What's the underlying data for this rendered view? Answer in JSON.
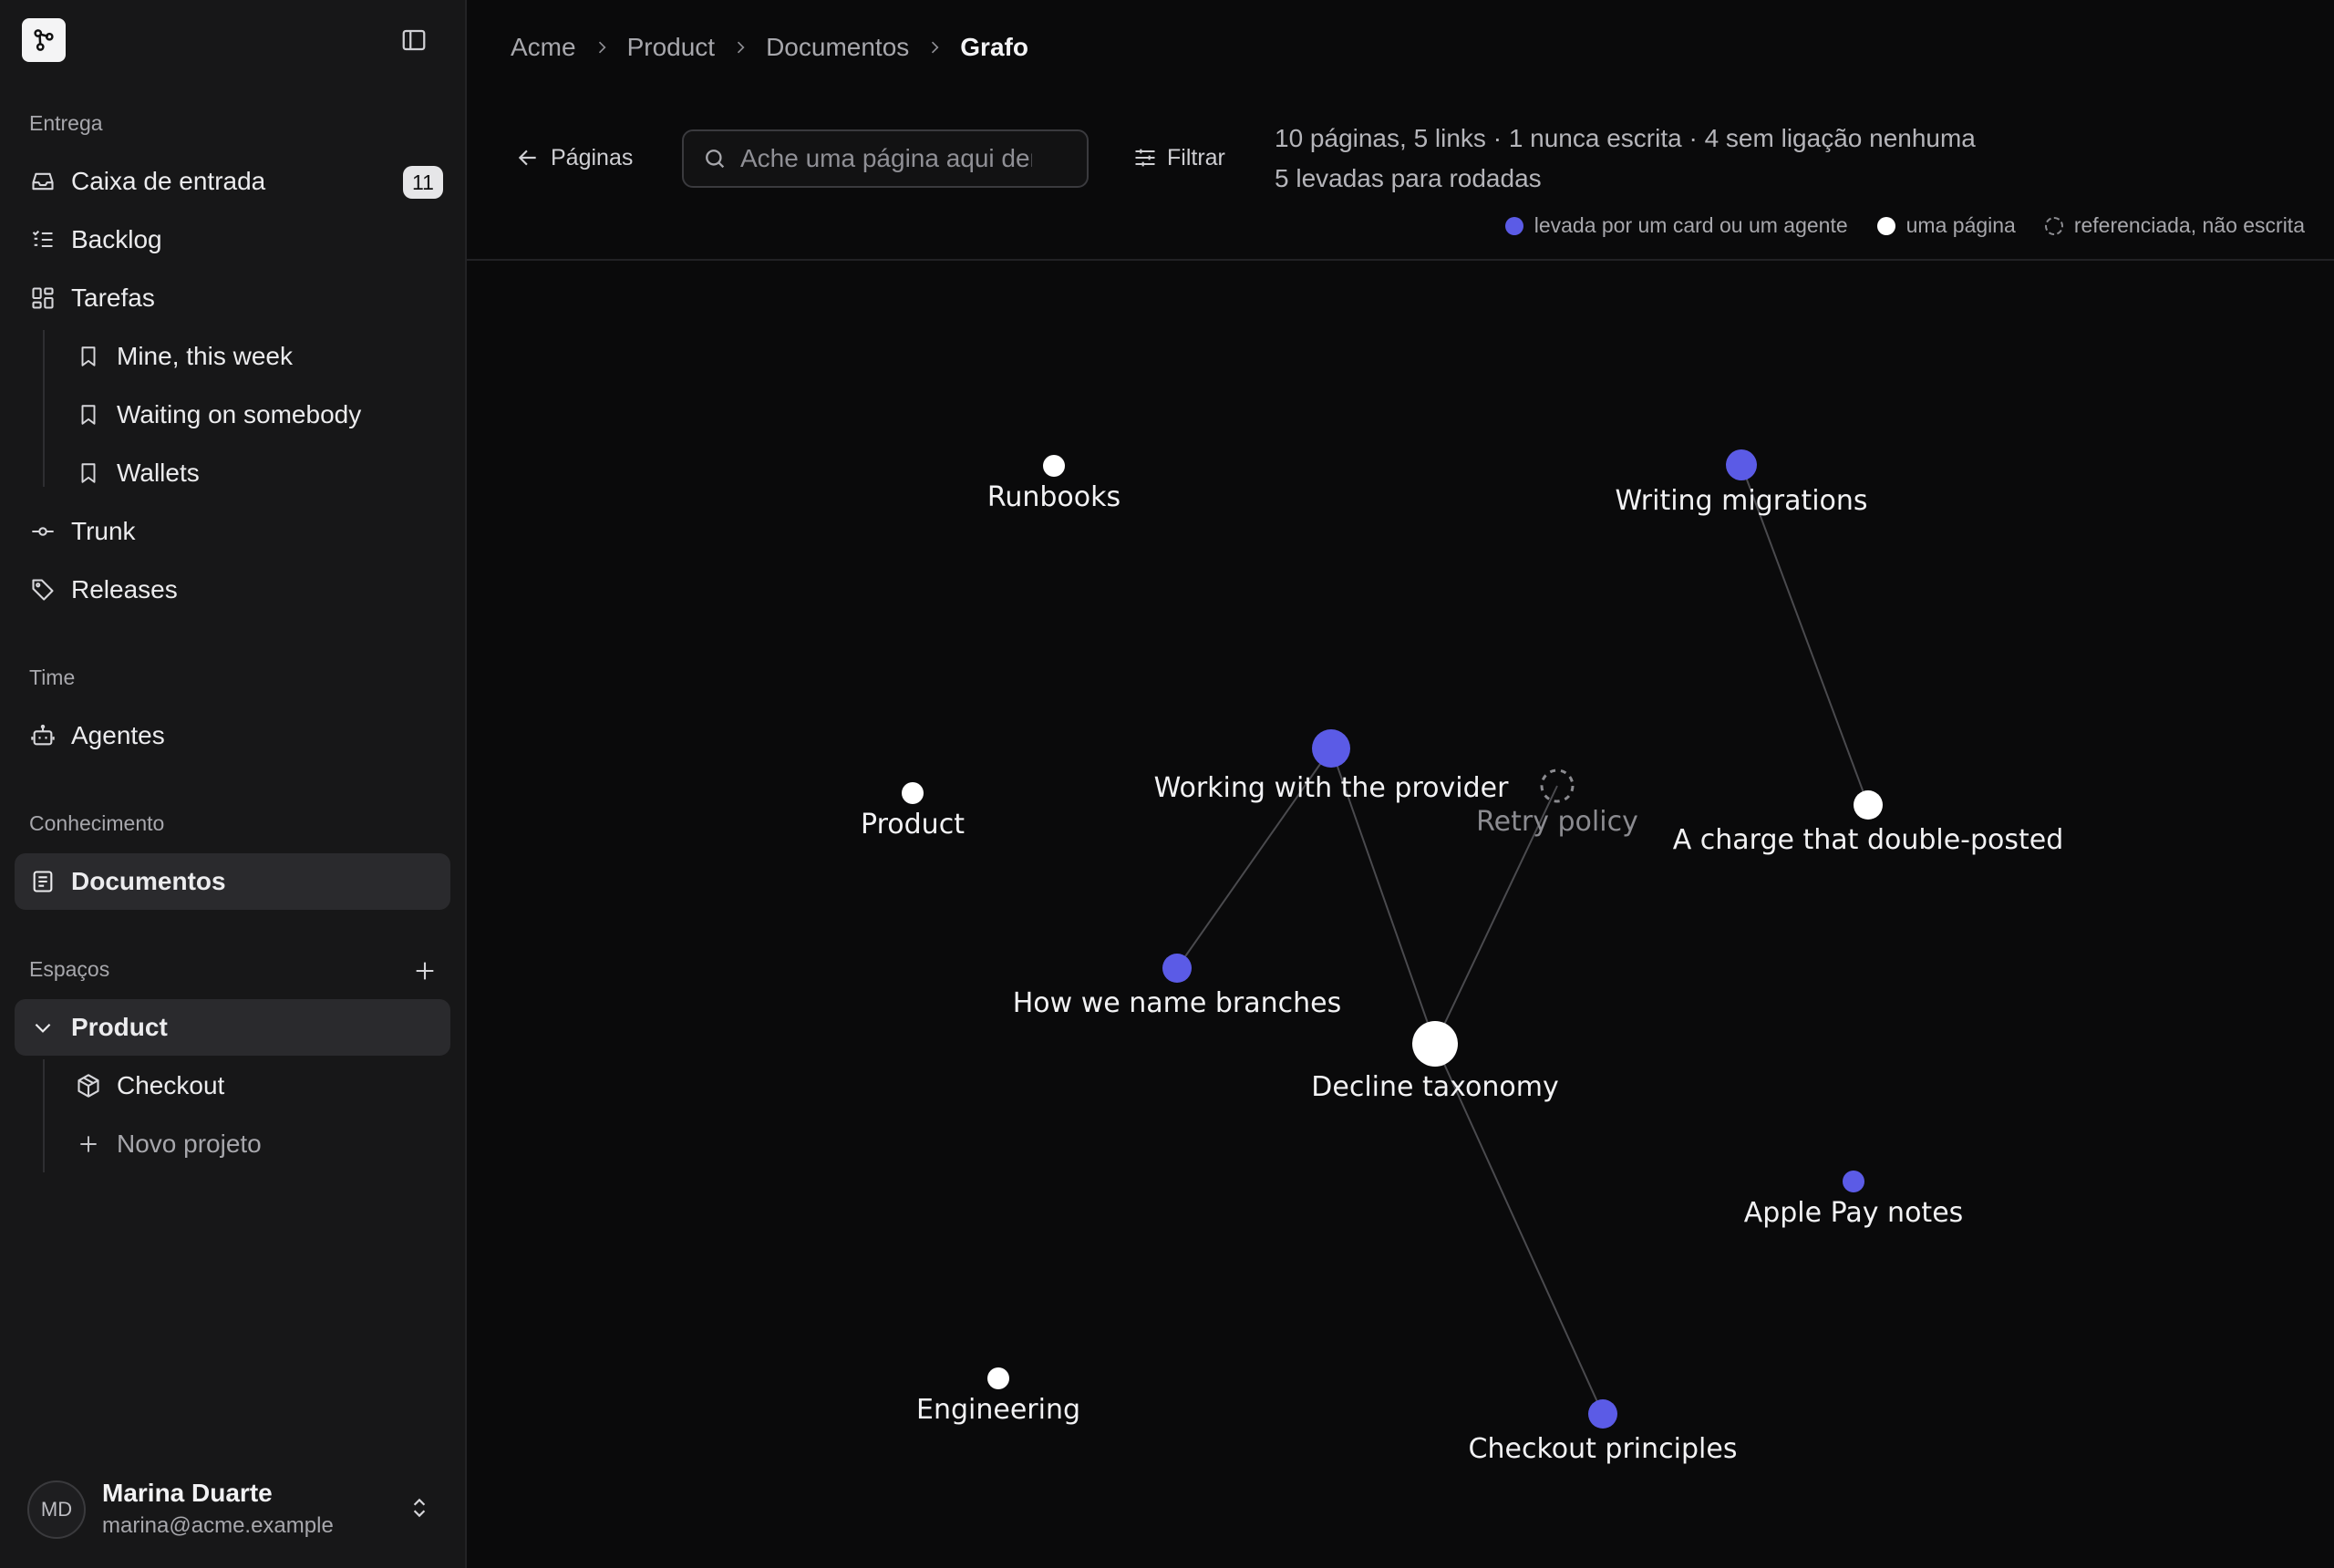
{
  "sidebar": {
    "sections": {
      "entrega": "Entrega",
      "time": "Time",
      "conhecimento": "Conhecimento",
      "espacos": "Espaços"
    },
    "items": {
      "inbox": {
        "label": "Caixa de entrada",
        "badge": "11",
        "icon": "inbox-icon"
      },
      "backlog": {
        "label": "Backlog",
        "icon": "list-checks-icon"
      },
      "tasks": {
        "label": "Tarefas",
        "icon": "grid-icon"
      },
      "mine": {
        "label": "Mine, this week",
        "icon": "bookmark-icon"
      },
      "waiting": {
        "label": "Waiting on somebody",
        "icon": "bookmark-icon"
      },
      "wallets": {
        "label": "Wallets",
        "icon": "bookmark-icon"
      },
      "trunk": {
        "label": "Trunk",
        "icon": "commit-icon"
      },
      "releases": {
        "label": "Releases",
        "icon": "tag-icon"
      },
      "agents": {
        "label": "Agentes",
        "icon": "bot-icon"
      },
      "documents": {
        "label": "Documentos",
        "icon": "document-icon"
      },
      "product": {
        "label": "Product",
        "icon": "chevron-down-icon"
      },
      "checkout": {
        "label": "Checkout",
        "icon": "box-icon"
      },
      "new_project": {
        "label": "Novo projeto",
        "icon": "plus-icon"
      }
    },
    "user": {
      "initials": "MD",
      "name": "Marina Duarte",
      "email": "marina@acme.example"
    }
  },
  "breadcrumb": [
    "Acme",
    "Product",
    "Documentos",
    "Grafo"
  ],
  "toolbar": {
    "back_label": "Páginas",
    "search_placeholder": "Ache uma página aqui dentro",
    "filter_label": "Filtrar"
  },
  "stats": {
    "line1": "10 páginas, 5 links · 1 nunca escrita · 4 sem ligação nenhuma",
    "line2": "5 levadas para rodadas"
  },
  "legend": [
    {
      "label": "levada por um card ou um agente",
      "style": "agent"
    },
    {
      "label": "uma página",
      "style": "page"
    },
    {
      "label": "referenciada, não escrita",
      "style": "ghost"
    }
  ],
  "colors": {
    "agent": "#5b5be6",
    "page": "#ffffff",
    "ghost": "#8b8b90",
    "edge": "#4a4a4e"
  },
  "graph": {
    "nodes": [
      {
        "id": "runbooks",
        "label": "Runbooks",
        "type": "page"
      },
      {
        "id": "writing-migrations",
        "label": "Writing migrations",
        "type": "agent"
      },
      {
        "id": "product",
        "label": "Product",
        "type": "page"
      },
      {
        "id": "working-provider",
        "label": "Working with the provider",
        "type": "agent"
      },
      {
        "id": "retry-policy",
        "label": "Retry policy",
        "type": "ghost"
      },
      {
        "id": "charge-double",
        "label": "A charge that double-posted",
        "type": "page"
      },
      {
        "id": "name-branches",
        "label": "How we name branches",
        "type": "agent"
      },
      {
        "id": "decline-taxonomy",
        "label": "Decline taxonomy",
        "type": "page"
      },
      {
        "id": "apple-pay",
        "label": "Apple Pay notes",
        "type": "agent"
      },
      {
        "id": "engineering",
        "label": "Engineering",
        "type": "page"
      },
      {
        "id": "checkout-principles",
        "label": "Checkout principles",
        "type": "agent"
      }
    ],
    "edges": [
      [
        "writing-migrations",
        "charge-double"
      ],
      [
        "working-provider",
        "name-branches"
      ],
      [
        "working-provider",
        "decline-taxonomy"
      ],
      [
        "retry-policy",
        "decline-taxonomy"
      ],
      [
        "decline-taxonomy",
        "checkout-principles"
      ]
    ]
  }
}
